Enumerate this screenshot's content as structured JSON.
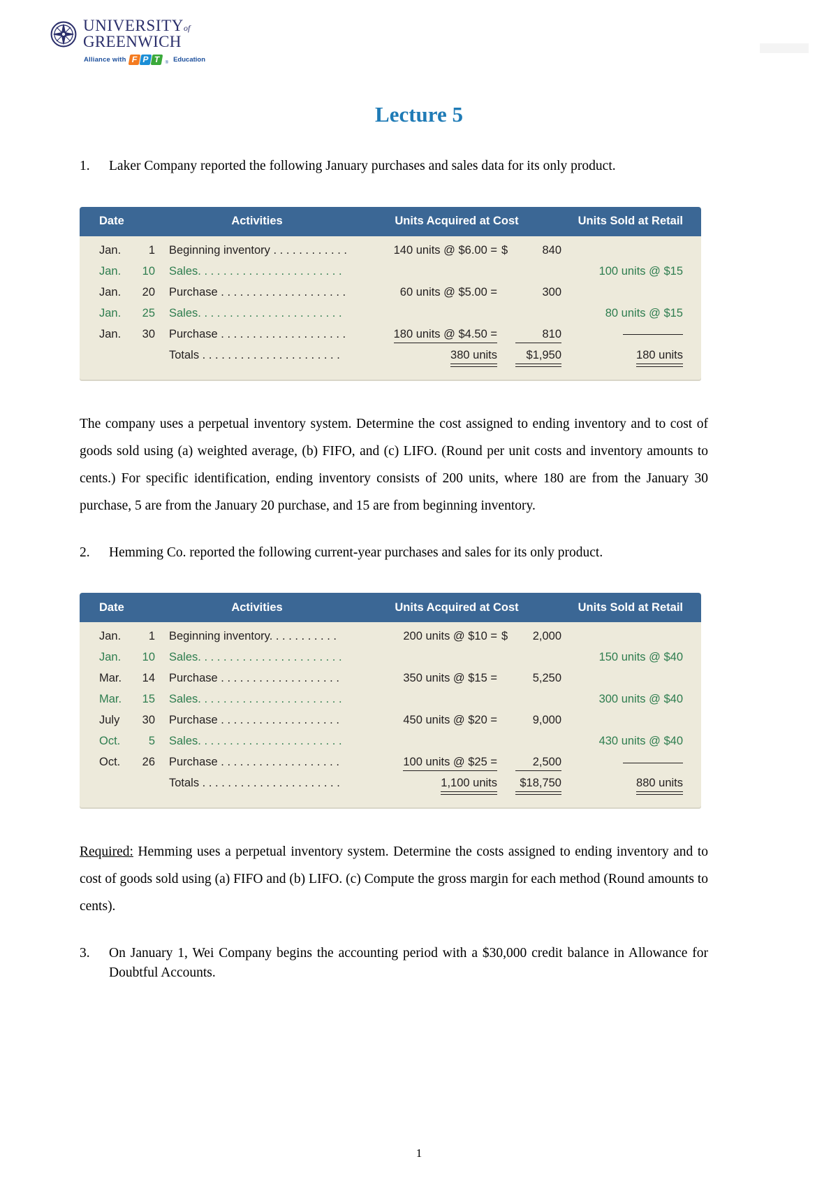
{
  "branding": {
    "university_line1": "UNIVERSITY",
    "university_of": "of",
    "university_line2": "GREENWICH",
    "alliance_text": "Alliance with",
    "fpt_f": "F",
    "fpt_p": "P",
    "fpt_t": "T",
    "fpt_reg": "®",
    "education_text": "Education",
    "logo_icon": "compass-rose-icon"
  },
  "title": "Lecture 5",
  "questions": [
    {
      "number": "1.",
      "text": "Laker Company reported the following January purchases and sales data for its only product."
    },
    {
      "number": "2.",
      "text": "Hemming Co. reported the following current-year purchases and sales for its only product."
    },
    {
      "number": "3.",
      "text": "On January 1, Wei Company begins the accounting period with a $30,000 credit balance in Allowance for Doubtful Accounts."
    }
  ],
  "paragraph_1": "The company uses a perpetual inventory system. Determine the cost assigned to ending inventory and to cost of goods sold using (a) weighted average, (b) FIFO, and (c) LIFO. (Round per unit costs and inventory amounts to cents.) For specific identification, ending inventory consists of 200 units, where 180 are from the January 30 purchase, 5 are from the January 20 purchase, and 15 are from beginning inventory.",
  "paragraph_2_lead": "Required:",
  "paragraph_2": " Hemming uses a perpetual inventory system. Determine the costs assigned to ending inventory and to cost of goods sold using (a) FIFO and (b) LIFO. (c) Compute the gross margin for each method (Round amounts to cents).",
  "table_1": {
    "headers": {
      "date": "Date",
      "activities": "Activities",
      "cost": "Units Acquired at Cost",
      "retail": "Units Sold at Retail"
    },
    "rows": [
      {
        "month": "Jan.",
        "day": "1",
        "activity": "Beginning inventory . . . . . . . . . . . .",
        "cost_units": "140 units @ $6.00 =",
        "cost_dollar": "$",
        "cost_amount": "840",
        "retail": "",
        "green": false
      },
      {
        "month": "Jan.",
        "day": "10",
        "activity": "Sales. . . . . . . . . . . . . . . . . . . . . . .",
        "cost_units": "",
        "cost_dollar": "",
        "cost_amount": "",
        "retail": "100 units @ $15",
        "green": true
      },
      {
        "month": "Jan.",
        "day": "20",
        "activity": "Purchase . . . . . . . . . . . . . . . . . . . .",
        "cost_units": "60 units @ $5.00 =",
        "cost_dollar": "",
        "cost_amount": "300",
        "retail": "",
        "green": false
      },
      {
        "month": "Jan.",
        "day": "25",
        "activity": "Sales. . . . . . . . . . . . . . . . . . . . . . .",
        "cost_units": "",
        "cost_dollar": "",
        "cost_amount": "",
        "retail": "80 units @ $15",
        "green": true
      },
      {
        "month": "Jan.",
        "day": "30",
        "activity": "Purchase . . . . . . . . . . . . . . . . . . . .",
        "cost_units": "180 units @ $4.50 =",
        "cost_dollar": "",
        "cost_amount": "810",
        "retail": "",
        "green": false,
        "underline_cost": true,
        "rule_retail": true
      }
    ],
    "totals": {
      "label": "Totals . . . . . . . . . . . . . . . . . . . . . .",
      "units": "380 units",
      "amount": "$1,950",
      "retail": "180 units"
    }
  },
  "table_2": {
    "headers": {
      "date": "Date",
      "activities": "Activities",
      "cost": "Units Acquired at Cost",
      "retail": "Units Sold at Retail"
    },
    "rows": [
      {
        "month": "Jan.",
        "day": "1",
        "activity": "Beginning inventory. . . . . . . . . . .",
        "cost_units": "200 units @ $10 =",
        "cost_dollar": "$",
        "cost_amount": "2,000",
        "retail": "",
        "green": false
      },
      {
        "month": "Jan.",
        "day": "10",
        "activity": "Sales. . . . . . . . . . . . . . . . . . . . . . .",
        "cost_units": "",
        "cost_dollar": "",
        "cost_amount": "",
        "retail": "150 units @ $40",
        "green": true
      },
      {
        "month": "Mar.",
        "day": "14",
        "activity": "Purchase . . . . . . . . . . . . . . . . . . .",
        "cost_units": "350 units @ $15 =",
        "cost_dollar": "",
        "cost_amount": "5,250",
        "retail": "",
        "green": false
      },
      {
        "month": "Mar.",
        "day": "15",
        "activity": "Sales. . . . . . . . . . . . . . . . . . . . . . .",
        "cost_units": "",
        "cost_dollar": "",
        "cost_amount": "",
        "retail": "300 units @ $40",
        "green": true
      },
      {
        "month": "July",
        "day": "30",
        "activity": "Purchase . . . . . . . . . . . . . . . . . . .",
        "cost_units": "450 units @ $20 =",
        "cost_dollar": "",
        "cost_amount": "9,000",
        "retail": "",
        "green": false
      },
      {
        "month": "Oct.",
        "day": "5",
        "activity": "Sales. . . . . . . . . . . . . . . . . . . . . . .",
        "cost_units": "",
        "cost_dollar": "",
        "cost_amount": "",
        "retail": "430 units @ $40",
        "green": true
      },
      {
        "month": "Oct.",
        "day": "26",
        "activity": "Purchase . . . . . . . . . . . . . . . . . . .",
        "cost_units": "100 units @ $25 =",
        "cost_dollar": "",
        "cost_amount": "2,500",
        "retail": "",
        "green": false,
        "underline_cost": true,
        "rule_retail": true
      }
    ],
    "totals": {
      "label": "Totals . . . . . . . . . . . . . . . . . . . . . .",
      "units": "1,100 units",
      "amount": "$18,750",
      "retail": "880 units"
    }
  },
  "page_number": "1"
}
